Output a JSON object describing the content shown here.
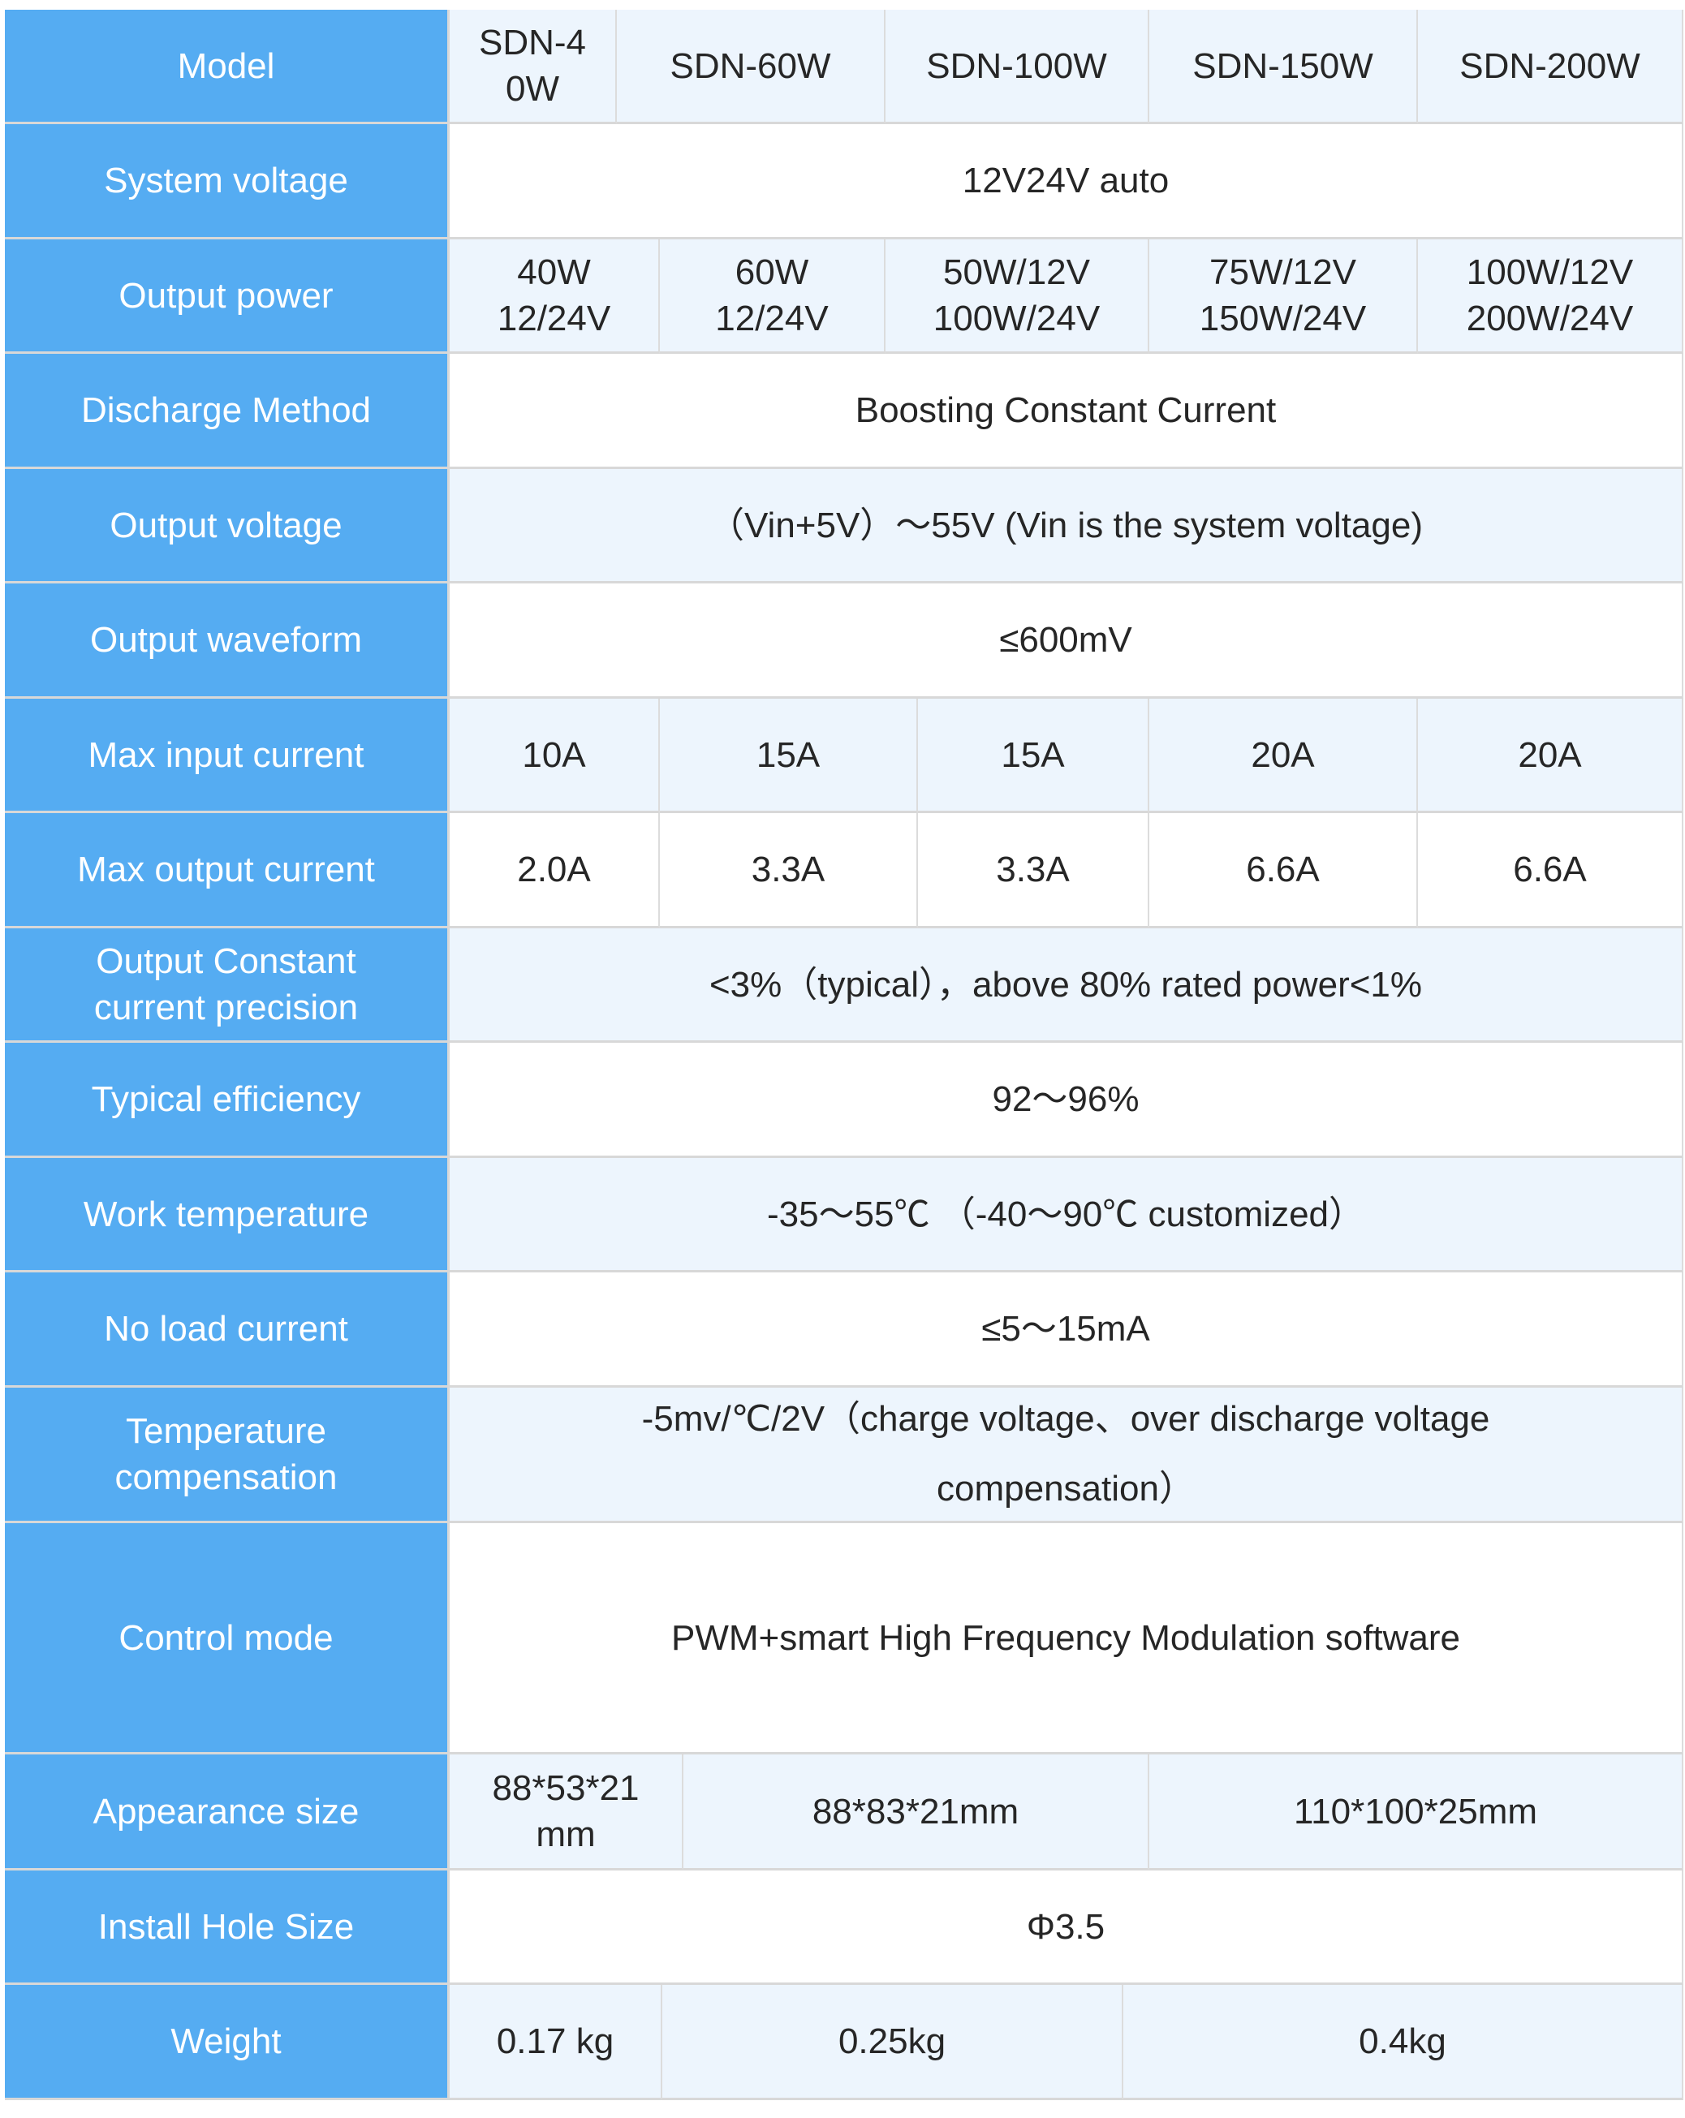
{
  "colors": {
    "header_bg": "#55acf2",
    "header_text": "#ffffff",
    "alt_row_bg": "#edf5fd",
    "row_bg": "#ffffff",
    "text": "#262626",
    "border": "#d8d8d8"
  },
  "rows": [
    {
      "label": "Model",
      "cells": [
        "SDN-4\n0W",
        "SDN-60W",
        "SDN-100W",
        "SDN-150W",
        "SDN-200W"
      ]
    },
    {
      "label": "System voltage",
      "cells": [
        "12V24V auto"
      ]
    },
    {
      "label": "Output power",
      "cells": [
        "40W\n12/24V",
        "60W\n12/24V",
        "50W/12V\n100W/24V",
        "75W/12V\n150W/24V",
        "100W/12V\n200W/24V"
      ]
    },
    {
      "label": "Discharge Method",
      "cells": [
        "Boosting Constant Current"
      ]
    },
    {
      "label": "Output voltage",
      "cells": [
        "（Vin+5V）～55V (Vin is the system voltage)"
      ]
    },
    {
      "label": "Output waveform",
      "cells": [
        "≤600mV"
      ]
    },
    {
      "label": "Max input current",
      "cells": [
        "10A",
        "15A",
        "15A",
        "20A",
        "20A"
      ]
    },
    {
      "label": "Max output current",
      "cells": [
        "2.0A",
        "3.3A",
        "3.3A",
        "6.6A",
        "6.6A"
      ]
    },
    {
      "label": "Output Constant\ncurrent precision",
      "cells": [
        "<3%（typical），above 80% rated power<1%"
      ]
    },
    {
      "label": "Typical efficiency",
      "cells": [
        "92～96%"
      ]
    },
    {
      "label": "Work temperature",
      "cells": [
        "-35～55℃ （-40～90℃ customized）"
      ]
    },
    {
      "label": "No load current",
      "cells": [
        "≤5～15mA"
      ]
    },
    {
      "label": "Temperature\ncompensation",
      "cells": [
        "-5mv/℃/2V（charge voltage、over discharge voltage\ncompensation）"
      ]
    },
    {
      "label": "Control mode",
      "cells": [
        "PWM+smart High Frequency Modulation software"
      ]
    },
    {
      "label": "Appearance size",
      "cells": [
        "88*53*21\nmm",
        "88*83*21mm",
        "110*100*25mm"
      ]
    },
    {
      "label": "Install Hole Size",
      "cells": [
        "Φ3.5"
      ]
    },
    {
      "label": "Weight",
      "cells": [
        "0.17 kg",
        "0.25kg",
        "0.4kg"
      ]
    }
  ]
}
